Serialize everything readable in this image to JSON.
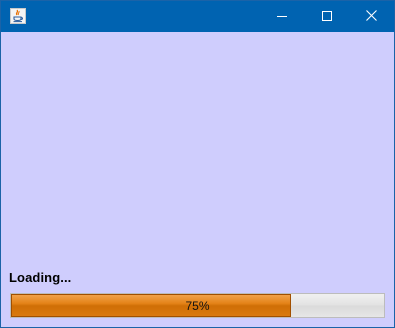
{
  "window": {
    "app_icon": "java-icon",
    "controls": {
      "minimize_icon": "minimize-icon",
      "maximize_icon": "maximize-icon",
      "close_icon": "close-icon"
    },
    "titlebar_color": "#0063b1"
  },
  "content": {
    "background_color": "#cfcdfd",
    "status_label": "Loading...",
    "progress": {
      "value": 0.75,
      "text": "75%",
      "fill_color": "#e48318"
    }
  }
}
